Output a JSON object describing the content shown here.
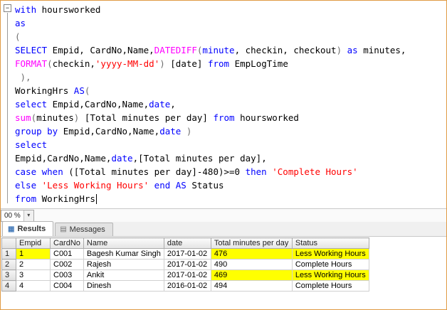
{
  "editor": {
    "lines": [
      [
        {
          "t": "with",
          "c": "kw"
        },
        {
          "t": " hoursworked",
          "c": "id"
        }
      ],
      [
        {
          "t": "as",
          "c": "kw"
        }
      ],
      [
        {
          "t": "(",
          "c": "op"
        }
      ],
      [
        {
          "t": "SELECT",
          "c": "kw"
        },
        {
          "t": " Empid, CardNo,Name,",
          "c": "id"
        },
        {
          "t": "DATEDIFF",
          "c": "fn"
        },
        {
          "t": "(",
          "c": "op"
        },
        {
          "t": "minute",
          "c": "kw"
        },
        {
          "t": ", checkin, checkout",
          "c": "id"
        },
        {
          "t": ")",
          "c": "op"
        },
        {
          "t": " as",
          "c": "kw"
        },
        {
          "t": " minutes,",
          "c": "id"
        }
      ],
      [
        {
          "t": "FORMAT",
          "c": "fn"
        },
        {
          "t": "(",
          "c": "op"
        },
        {
          "t": "checkin,",
          "c": "id"
        },
        {
          "t": "'yyyy-MM-dd'",
          "c": "str"
        },
        {
          "t": ")",
          "c": "op"
        },
        {
          "t": " [date] ",
          "c": "id"
        },
        {
          "t": "from",
          "c": "kw"
        },
        {
          "t": " EmpLogTime",
          "c": "id"
        }
      ],
      [
        {
          "t": " ),",
          "c": "op"
        }
      ],
      [
        {
          "t": "WorkingHrs ",
          "c": "id"
        },
        {
          "t": "AS",
          "c": "kw"
        },
        {
          "t": "(",
          "c": "op"
        }
      ],
      [
        {
          "t": "select",
          "c": "kw"
        },
        {
          "t": " Empid,CardNo,Name,",
          "c": "id"
        },
        {
          "t": "date",
          "c": "kw"
        },
        {
          "t": ",",
          "c": "id"
        }
      ],
      [
        {
          "t": "sum",
          "c": "fn"
        },
        {
          "t": "(",
          "c": "op"
        },
        {
          "t": "minutes",
          "c": "id"
        },
        {
          "t": ")",
          "c": "op"
        },
        {
          "t": " [Total minutes per day] ",
          "c": "id"
        },
        {
          "t": "from",
          "c": "kw"
        },
        {
          "t": " hoursworked",
          "c": "id"
        }
      ],
      [
        {
          "t": "group by",
          "c": "kw"
        },
        {
          "t": " Empid,CardNo,Name,",
          "c": "id"
        },
        {
          "t": "date",
          "c": "kw"
        },
        {
          "t": " )",
          "c": "op"
        }
      ],
      [
        {
          "t": "select",
          "c": "kw"
        }
      ],
      [
        {
          "t": "Empid,CardNo,Name,",
          "c": "id"
        },
        {
          "t": "date",
          "c": "kw"
        },
        {
          "t": ",[Total minutes per day],",
          "c": "id"
        }
      ],
      [
        {
          "t": "case when",
          "c": "kw"
        },
        {
          "t": " ([Total minutes per day]-480)>=0 ",
          "c": "id"
        },
        {
          "t": "then",
          "c": "kw"
        },
        {
          "t": " 'Complete Hours'",
          "c": "str"
        }
      ],
      [
        {
          "t": "else",
          "c": "kw"
        },
        {
          "t": " 'Less Working Hours'",
          "c": "str"
        },
        {
          "t": " end AS",
          "c": "kw"
        },
        {
          "t": " Status",
          "c": "id"
        }
      ],
      [
        {
          "t": "from",
          "c": "kw"
        },
        {
          "t": " WorkingHrs",
          "c": "id"
        }
      ]
    ]
  },
  "statusbar": {
    "zoom": "00 %"
  },
  "tabs": {
    "results": "Results",
    "messages": "Messages"
  },
  "icons": {
    "collapse_marker": "−",
    "zoom_dropdown_arrow": "▾",
    "results_tab_icon": "▦",
    "messages_tab_icon": "▤"
  },
  "colors": {
    "keyword": "#0000ff",
    "function": "#ff00ff",
    "string": "#ff0000",
    "highlight": "#ffff00"
  },
  "grid": {
    "columns": [
      "",
      "Empid",
      "CardNo",
      "Name",
      "date",
      "Total minutes per day",
      "Status"
    ],
    "rows": [
      {
        "cells": [
          "1",
          "1",
          "C001",
          "Bagesh Kumar Singh",
          "2017-01-02",
          "476",
          "Less Working Hours"
        ],
        "highlight": [
          1,
          5,
          6
        ]
      },
      {
        "cells": [
          "2",
          "2",
          "C002",
          "Rajesh",
          "2017-01-02",
          "490",
          "Complete Hours"
        ],
        "highlight": []
      },
      {
        "cells": [
          "3",
          "3",
          "C003",
          "Ankit",
          "2017-01-02",
          "469",
          "Less Working Hours"
        ],
        "highlight": [
          5,
          6
        ]
      },
      {
        "cells": [
          "4",
          "4",
          "C004",
          "Dinesh",
          "2016-01-02",
          "494",
          "Complete Hours"
        ],
        "highlight": []
      }
    ]
  }
}
